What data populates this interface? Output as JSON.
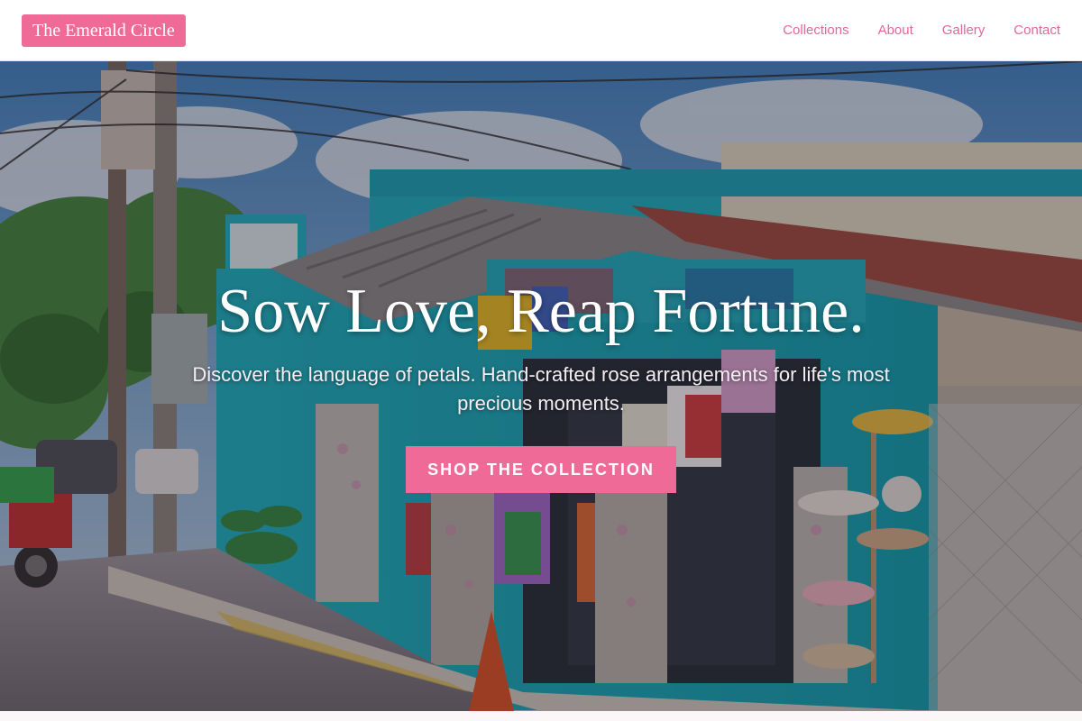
{
  "header": {
    "brand": "The Emerald Circle",
    "nav": [
      "Collections",
      "About",
      "Gallery",
      "Contact"
    ]
  },
  "hero": {
    "title": "Sow Love, Reap Fortune.",
    "subtitle": "Discover the language of petals. Hand-crafted rose arrangements for life's most precious moments.",
    "cta_label": "SHOP THE COLLECTION",
    "background_image": "street-shop-photo"
  },
  "colors": {
    "accent": "#ef6a97",
    "nav_link": "#e0699a",
    "header_bg": "#ffffff"
  }
}
